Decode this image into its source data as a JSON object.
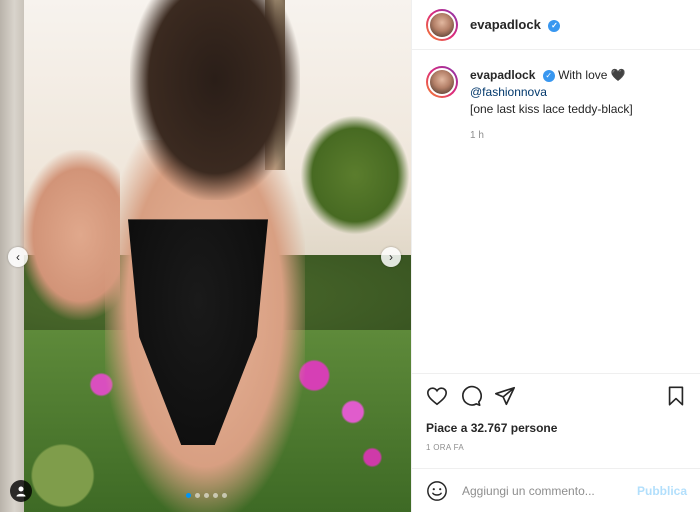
{
  "media": {
    "carousel_total": 5,
    "carousel_active": 0
  },
  "post": {
    "username": "evapadlock",
    "caption_text": "With love",
    "caption_emoji": "🖤",
    "mention": "@fashionnova",
    "caption_line2": "[one last kiss lace teddy-black]",
    "caption_time": "1 h"
  },
  "engagement": {
    "likes_text": "Piace a 32.767 persone",
    "timestamp": "1 ORA FA"
  },
  "comment": {
    "placeholder": "Aggiungi un commento...",
    "publish_label": "Pubblica"
  },
  "colors": {
    "accent": "#0095f6",
    "verified": "#3897f0",
    "publish_disabled": "#b2dffc"
  }
}
